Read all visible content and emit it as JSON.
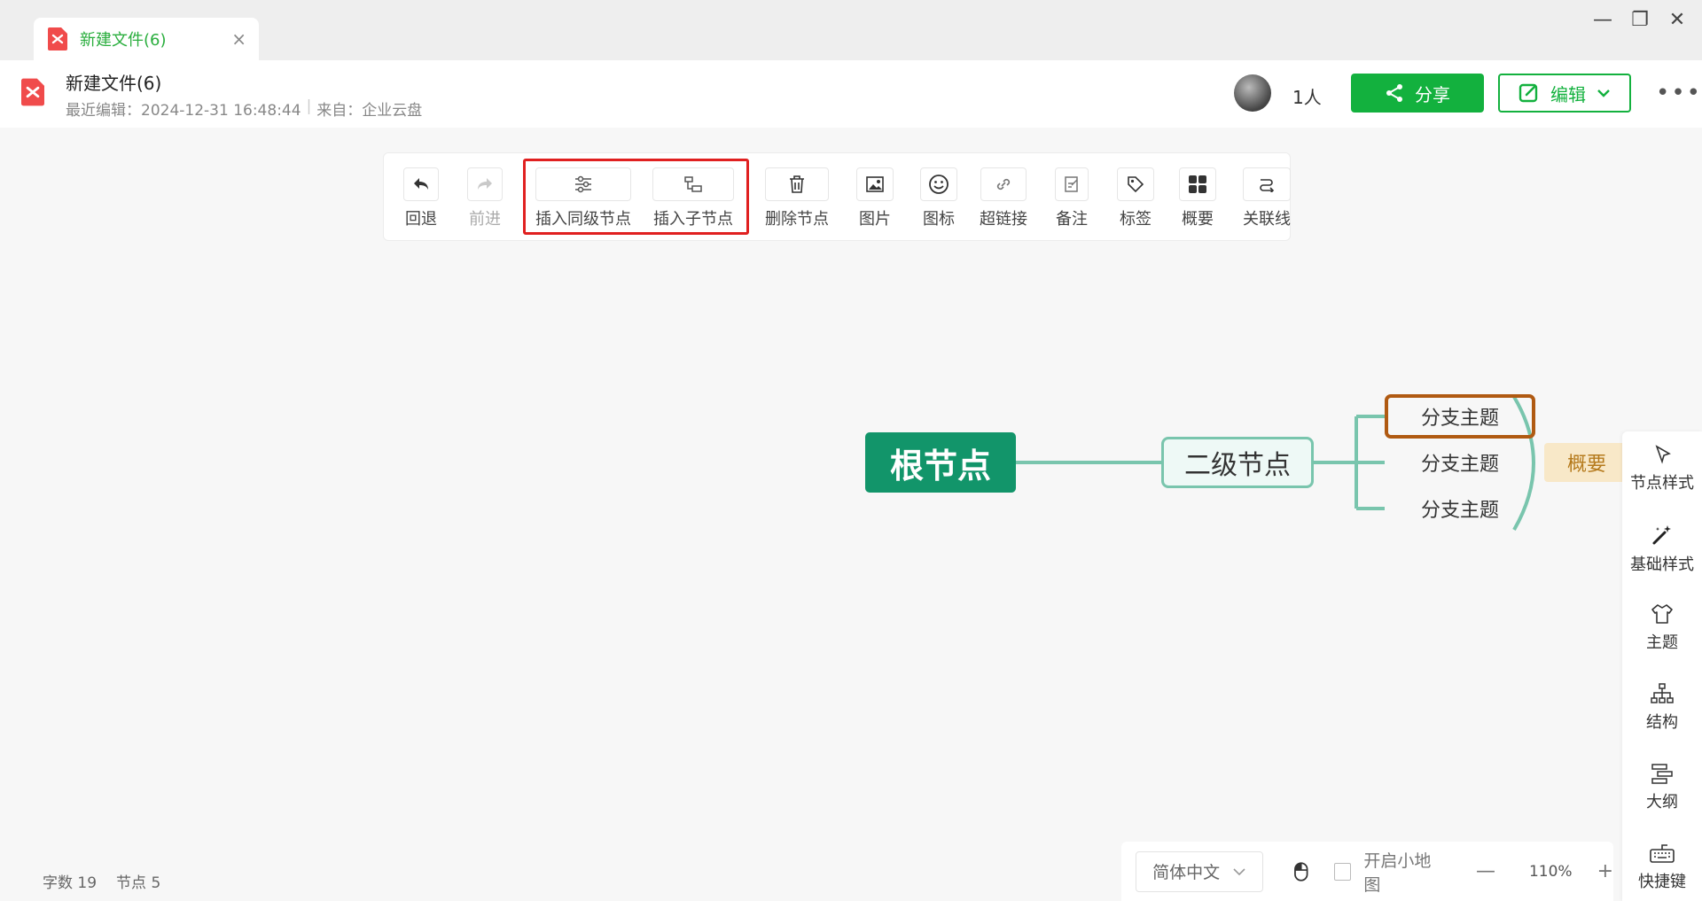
{
  "window": {
    "tab_title": "新建文件(6)",
    "close_glyph": "×",
    "minimize_glyph": "—",
    "restore_glyph": "❐",
    "close_window_glyph": "✕"
  },
  "header": {
    "title": "新建文件(6)",
    "last_edit": "最近编辑：2024-12-31 16:48:44",
    "separator": "|",
    "source": "来自：企业云盘",
    "user_count": "1人",
    "share_label": "分享",
    "edit_label": "编辑",
    "more_glyph": "•••"
  },
  "toolbar": {
    "undo": "回退",
    "redo": "前进",
    "insert_sibling": "插入同级节点",
    "insert_child": "插入子节点",
    "delete_node": "删除节点",
    "image": "图片",
    "icon": "图标",
    "hyperlink": "超链接",
    "note": "备注",
    "tag": "标签",
    "summary": "概要",
    "relation": "关联线"
  },
  "mindmap": {
    "root": "根节点",
    "level2": "二级节点",
    "branches": [
      "分支主题",
      "分支主题",
      "分支主题"
    ],
    "summary": "概要"
  },
  "sidebar": {
    "node_style": "节点样式",
    "basic_style": "基础样式",
    "theme": "主题",
    "structure": "结构",
    "outline": "大纲",
    "shortcuts": "快捷键"
  },
  "status": {
    "word_count_label": "字数",
    "word_count": "19",
    "node_count_label": "节点",
    "node_count": "5",
    "language": "简体中文",
    "minimap_label": "开启小地图",
    "zoom_minus": "—",
    "zoom": "110%",
    "zoom_plus": "+"
  },
  "colors": {
    "brand_green": "#13b13e",
    "root_fill": "#12956a",
    "connector": "#79c5ad",
    "selected_border": "#b05a12",
    "summary_fill": "#f8e8c8",
    "highlight_box": "#e02020"
  },
  "icons": [
    "file-icon",
    "undo-icon",
    "redo-icon",
    "insert-sibling-icon",
    "insert-child-icon",
    "trash-icon",
    "image-icon",
    "smiley-icon",
    "link-icon",
    "note-icon",
    "tag-icon",
    "grid-icon",
    "relation-icon",
    "share-icon",
    "edit-icon",
    "chevron-down-icon",
    "pointer-icon",
    "magic-wand-icon",
    "shirt-icon",
    "structure-icon",
    "outline-icon",
    "keyboard-icon",
    "mouse-icon"
  ]
}
